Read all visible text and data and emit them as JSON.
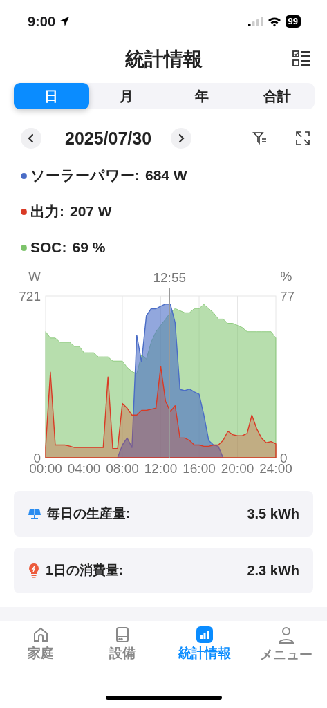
{
  "status_bar": {
    "time": "9:00",
    "battery": "99"
  },
  "header": {
    "title": "統計情報"
  },
  "period_tabs": [
    {
      "label": "日",
      "selected": true
    },
    {
      "label": "月",
      "selected": false
    },
    {
      "label": "年",
      "selected": false
    },
    {
      "label": "合計",
      "selected": false
    }
  ],
  "date_nav": {
    "date": "2025/07/30"
  },
  "legend": [
    {
      "label": "ソーラーパワー:",
      "value": "684 W",
      "color": "#4a6cc6"
    },
    {
      "label": "出力:",
      "value": "207 W",
      "color": "#d93a25"
    },
    {
      "label": "SOC:",
      "value": "69 %",
      "color": "#7cc36a"
    }
  ],
  "chart": {
    "chart_data": {
      "type": "area",
      "grid": true,
      "ylabel": "W",
      "y2label": "%",
      "xlim": [
        0,
        24
      ],
      "ylim": [
        0,
        721
      ],
      "y2lim": [
        0,
        77
      ],
      "yticks": [
        0,
        721
      ],
      "y2ticks": [
        0,
        77
      ],
      "xticks": [
        {
          "value": 0,
          "label": "00:00"
        },
        {
          "value": 4,
          "label": "04:00"
        },
        {
          "value": 8,
          "label": "08:00"
        },
        {
          "value": 12,
          "label": "12:00"
        },
        {
          "value": 16,
          "label": "16:00"
        },
        {
          "value": 20,
          "label": "20:00"
        },
        {
          "value": 24,
          "label": "24:00"
        }
      ],
      "x": [
        0,
        0.5,
        1,
        1.5,
        2,
        2.5,
        3,
        3.5,
        4,
        4.5,
        5,
        5.5,
        6,
        6.5,
        7,
        7.5,
        8,
        8.5,
        9,
        9.5,
        10,
        10.5,
        11,
        11.5,
        12,
        12.5,
        13,
        13.5,
        14,
        14.5,
        15,
        15.5,
        16,
        16.5,
        17,
        17.5,
        18,
        18.5,
        19,
        19.5,
        20,
        20.5,
        21,
        21.5,
        22,
        22.5,
        23,
        23.5,
        24
      ],
      "series": [
        {
          "color": "#7cc36a",
          "axis": "y2",
          "values": [
            60,
            57,
            57,
            55,
            55,
            55,
            53,
            53,
            50,
            50,
            50,
            48,
            48,
            48,
            46,
            46,
            46,
            43,
            41,
            40,
            49,
            47,
            55,
            60,
            63,
            66,
            69,
            71,
            70,
            69,
            69,
            71,
            71,
            73,
            71,
            69,
            66,
            66,
            64,
            64,
            63,
            62,
            60,
            60,
            60,
            60,
            60,
            60,
            57
          ]
        },
        {
          "color": "#4a6cc6",
          "values": [
            null,
            null,
            null,
            null,
            null,
            null,
            null,
            null,
            null,
            null,
            null,
            null,
            null,
            null,
            null,
            0,
            57,
            88,
            46,
            546,
            427,
            633,
            664,
            664,
            675,
            685,
            685,
            602,
            304,
            299,
            306,
            293,
            283,
            190,
            77,
            57,
            51,
            0,
            null,
            null,
            null,
            null,
            null,
            null,
            null,
            null,
            null,
            null,
            null
          ]
        },
        {
          "color": "#d93a25",
          "values": [
            46,
            381,
            57,
            57,
            57,
            52,
            46,
            46,
            46,
            46,
            46,
            46,
            46,
            360,
            41,
            41,
            242,
            221,
            190,
            190,
            211,
            211,
            216,
            221,
            407,
            252,
            206,
            232,
            88,
            88,
            77,
            57,
            57,
            51,
            51,
            57,
            57,
            77,
            118,
            103,
            98,
            98,
            108,
            190,
            129,
            88,
            67,
            72,
            62
          ]
        }
      ],
      "annotations": [
        {
          "x": 12.92,
          "text": "12:55"
        }
      ]
    }
  },
  "summary": [
    {
      "kind": "solar",
      "label": "毎日の生産量:",
      "value": "3.5 kWh"
    },
    {
      "kind": "bulb",
      "label": "1日の消費量:",
      "value": "2.3 kWh"
    }
  ],
  "tab_bar": [
    {
      "kind": "home",
      "label": "家庭",
      "selected": false
    },
    {
      "kind": "device",
      "label": "設備",
      "selected": false
    },
    {
      "kind": "stats",
      "label": "統計情報",
      "selected": true
    },
    {
      "kind": "person",
      "label": "メニュー",
      "selected": false
    }
  ]
}
